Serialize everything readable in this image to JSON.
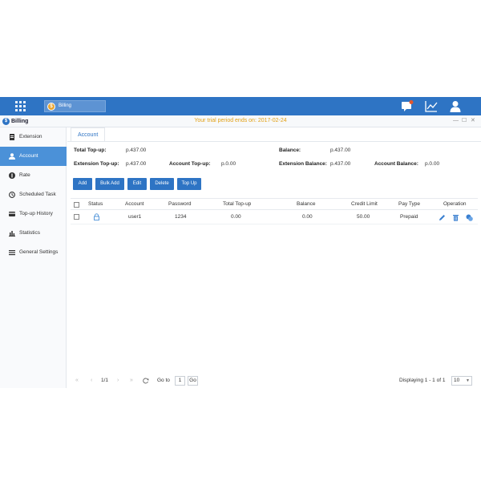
{
  "topbar": {
    "app_chip_label": "Billing",
    "icons": [
      "apps-grid-icon",
      "message-icon",
      "chart-icon",
      "user-icon"
    ],
    "brand_color": "#2e74c4"
  },
  "window": {
    "title": "Billing",
    "trial_notice": "Your trial period ends on: 2017-02-24",
    "controls": [
      "—",
      "☐",
      "✕"
    ]
  },
  "sidebar": {
    "items": [
      {
        "label": "Extension",
        "icon": "file-icon",
        "active": false
      },
      {
        "label": "Account",
        "icon": "person-icon",
        "active": true
      },
      {
        "label": "Rate",
        "icon": "rate-icon",
        "active": false
      },
      {
        "label": "Scheduled Task",
        "icon": "clock-icon",
        "active": false
      },
      {
        "label": "Top-up History",
        "icon": "history-icon",
        "active": false
      },
      {
        "label": "Statistics",
        "icon": "bar-chart-icon",
        "active": false
      },
      {
        "label": "General Settings",
        "icon": "list-icon",
        "active": false
      }
    ]
  },
  "main": {
    "tab": "Account",
    "summary": {
      "total_topup_label": "Total Top-up:",
      "total_topup_value": "p.437.00",
      "balance_label": "Balance:",
      "balance_value": "p.437.00",
      "ext_topup_label": "Extension Top-up:",
      "ext_topup_value": "p.437.00",
      "acct_topup_label": "Account Top-up:",
      "acct_topup_value": "p.0.00",
      "ext_balance_label": "Extension Balance:",
      "ext_balance_value": "p.437.00",
      "acct_balance_label": "Account Balance:",
      "acct_balance_value": "p.0.00"
    },
    "buttons": {
      "add": "Add",
      "bulk_add": "Bulk Add",
      "edit": "Edit",
      "delete": "Delete",
      "top_up": "Top Up"
    },
    "table": {
      "columns": [
        "Status",
        "Account",
        "Password",
        "Total Top-up",
        "Balance",
        "Credit Limit",
        "Pay Type",
        "Operation"
      ],
      "rows": [
        {
          "status_icon": "lock-icon",
          "account": "user1",
          "password": "1234",
          "total_topup": "0.00",
          "balance": "0.00",
          "credit_limit": "50.00",
          "pay_type": "Prepaid"
        }
      ]
    },
    "pagination": {
      "page_info": "1/1",
      "goto_label": "Go to",
      "goto_value": "1",
      "go_button": "Go",
      "displaying": "Displaying 1 - 1 of 1",
      "page_size": "10"
    }
  }
}
